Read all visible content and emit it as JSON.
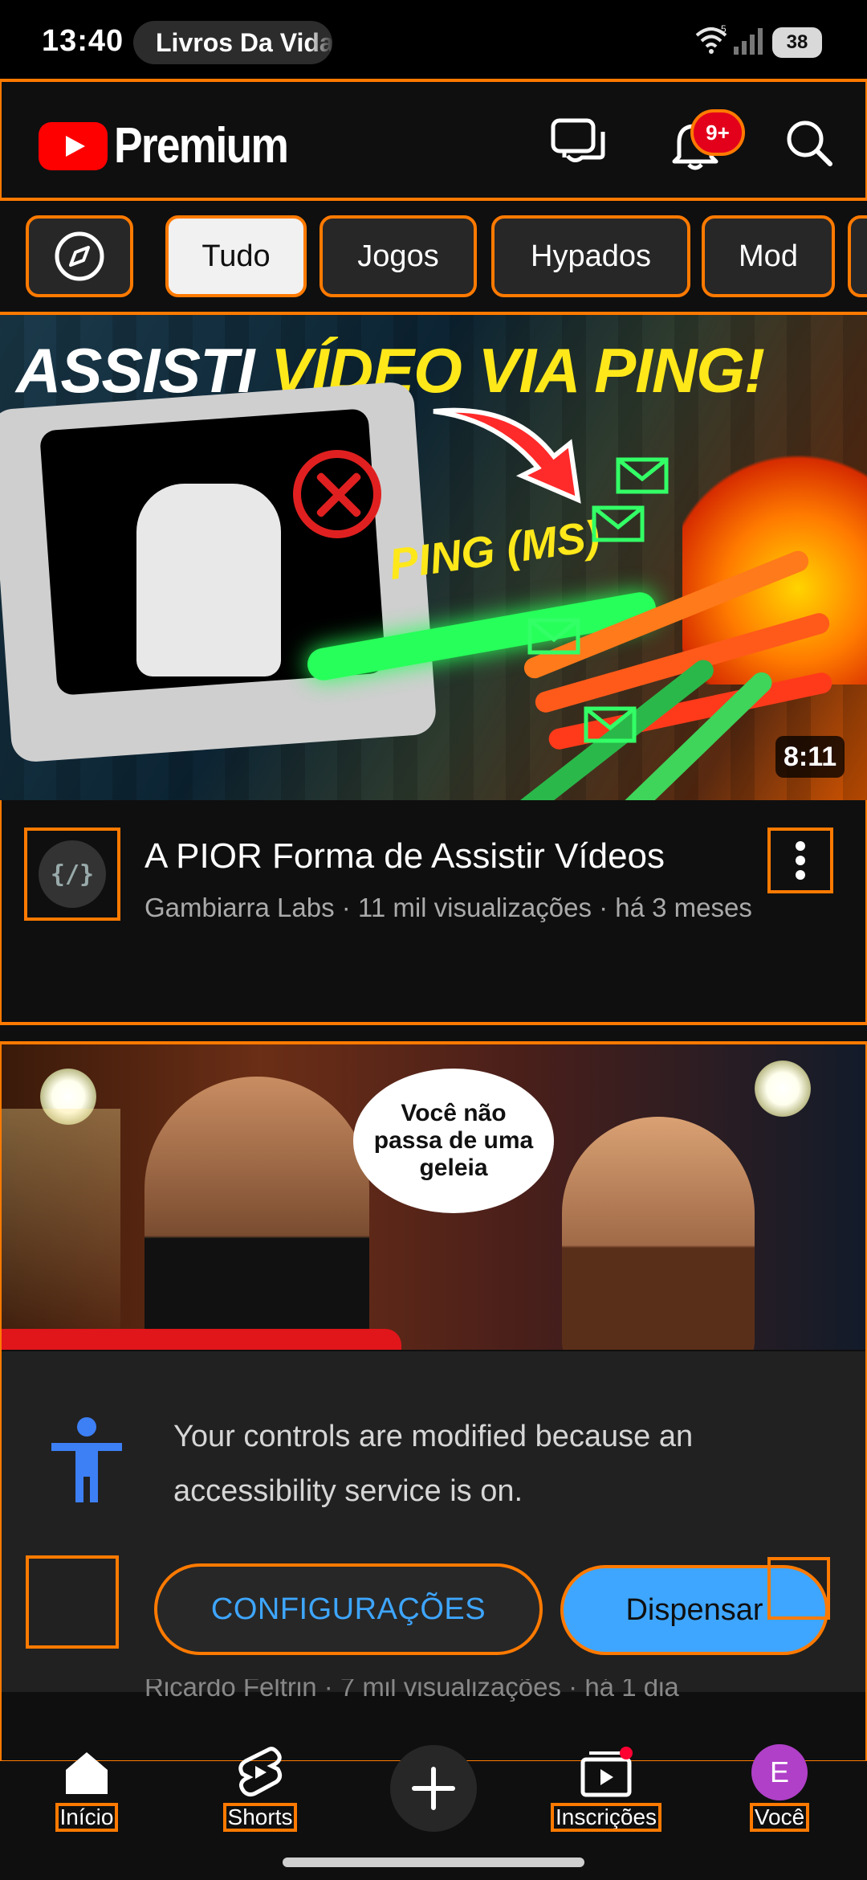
{
  "status_bar": {
    "time": "13:40",
    "media_title": "Livros Da Vida",
    "battery": "38",
    "wifi_badge": "5"
  },
  "header": {
    "brand": "Premium",
    "notifications_badge": "9+"
  },
  "chips": [
    {
      "label": "Tudo",
      "active": true
    },
    {
      "label": "Jogos"
    },
    {
      "label": "Hypados"
    },
    {
      "label": "Mod"
    }
  ],
  "videos": [
    {
      "thumbnail_text_white": "ASSISTI ",
      "thumbnail_text_yellow": "VÍDEO VIA PING!",
      "thumbnail_label": "PING (MS)",
      "duration": "8:11",
      "channel_avatar_text": "{/}",
      "title": "A PIOR Forma de Assistir Vídeos",
      "meta": "Gambiarra Labs · 11 mil visualizações · há 3 meses"
    },
    {
      "thumbnail_bubble": "Você não passa de uma geleia",
      "meta_partial": "Ricardo Feltrin · 7 mil visualizações · há 1 dia"
    }
  ],
  "accessibility_sheet": {
    "message": "Your controls are modified because an accessibility service is on.",
    "settings_label": "CONFIGURAÇÕES",
    "dismiss_label": "Dispensar"
  },
  "bottom_nav": {
    "home": "Início",
    "shorts": "Shorts",
    "subscriptions": "Inscrições",
    "you": "Você",
    "you_avatar": "E"
  },
  "colors": {
    "accent_blue": "#3ea6ff",
    "youtube_red": "#ff0000",
    "highlight": "#ff7a00",
    "background": "#0f0f0f"
  }
}
